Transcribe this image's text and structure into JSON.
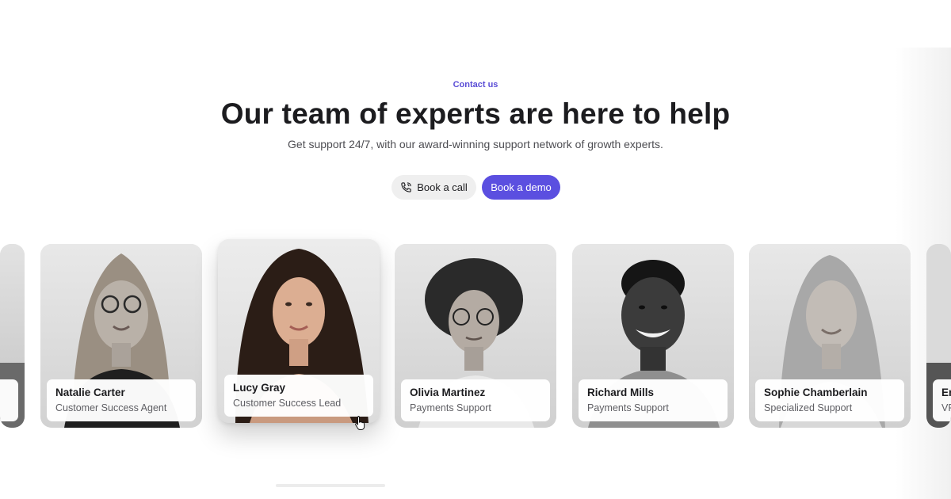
{
  "hero": {
    "eyebrow": "Contact us",
    "headline": "Our team of experts are here to help",
    "subhead": "Get support 24/7, with our award-winning support network of growth experts."
  },
  "actions": {
    "call_label": "Book a call",
    "demo_label": "Book a demo"
  },
  "team": [
    {
      "name": "",
      "role": ""
    },
    {
      "name": "Natalie Carter",
      "role": "Customer Success Agent"
    },
    {
      "name": "Lucy Gray",
      "role": "Customer Success Lead"
    },
    {
      "name": "Olivia Martinez",
      "role": "Payments Support"
    },
    {
      "name": "Richard Mills",
      "role": "Payments Support"
    },
    {
      "name": "Sophie Chamberlain",
      "role": "Specialized Support"
    },
    {
      "name": "Er",
      "role": "VP"
    }
  ],
  "colors": {
    "accent": "#5b4fe0",
    "eyebrow": "#5a4dd6",
    "heading": "#1c1c1f",
    "secondary_button_bg": "#efefef"
  },
  "icons": {
    "call_button_icon": "phone-icon",
    "pointer": "hand-pointer-icon"
  }
}
